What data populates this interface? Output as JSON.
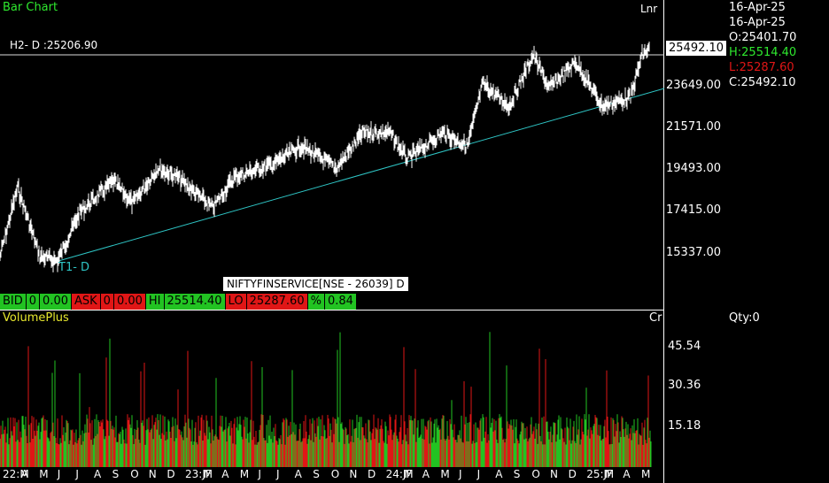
{
  "chart": {
    "title": "Bar Chart",
    "scale_mode": "Lnr",
    "h2_label": "H2- D :25206.90",
    "trend_label": "T1- D",
    "symbol": "NIFTYFINSERVICE[NSE - 26039] D",
    "last_price": "25492.10",
    "price_ticks": [
      "23649.00",
      "21571.00",
      "19493.00",
      "17415.00",
      "15337.00"
    ]
  },
  "ohlc": {
    "date1": "16-Apr-25",
    "date2": "16-Apr-25",
    "open": "O:25401.70",
    "high": "H:25514.40",
    "low": "L:25287.60",
    "close": "C:25492.10",
    "colors": {
      "open": "#ffffff",
      "high": "#2ee82e",
      "low": "#e01616",
      "close": "#ffffff"
    }
  },
  "quote_bar": {
    "bid_label": "BID",
    "bid_qty": "0",
    "bid_price": "0.00",
    "ask_label": "ASK",
    "ask_qty": "0",
    "ask_price": "0.00",
    "hi_label": "HI",
    "hi_value": "25514.40",
    "lo_label": "LO",
    "lo_value": "25287.60",
    "pct_label": "%",
    "pct_value": "0.84"
  },
  "volume": {
    "title": "VolumePlus",
    "unit": "Cr",
    "qty": "Qty:0",
    "ticks": [
      "45.54",
      "30.36",
      "15.18"
    ]
  },
  "x_axis": [
    "22:M",
    "A",
    "M",
    "J",
    "J",
    "A",
    "S",
    "O",
    "N",
    "D",
    "23:JF",
    "M",
    "A",
    "M",
    "J",
    "J",
    "A",
    "S",
    "O",
    "N",
    "D",
    "24:JF",
    "M",
    "A",
    "M",
    "J",
    "J",
    "A",
    "S",
    "O",
    "N",
    "D",
    "25:JF",
    "M",
    "A",
    "M"
  ],
  "colors": {
    "up": "#22c322",
    "down": "#e01616",
    "trendline": "#2ec4c4"
  }
}
